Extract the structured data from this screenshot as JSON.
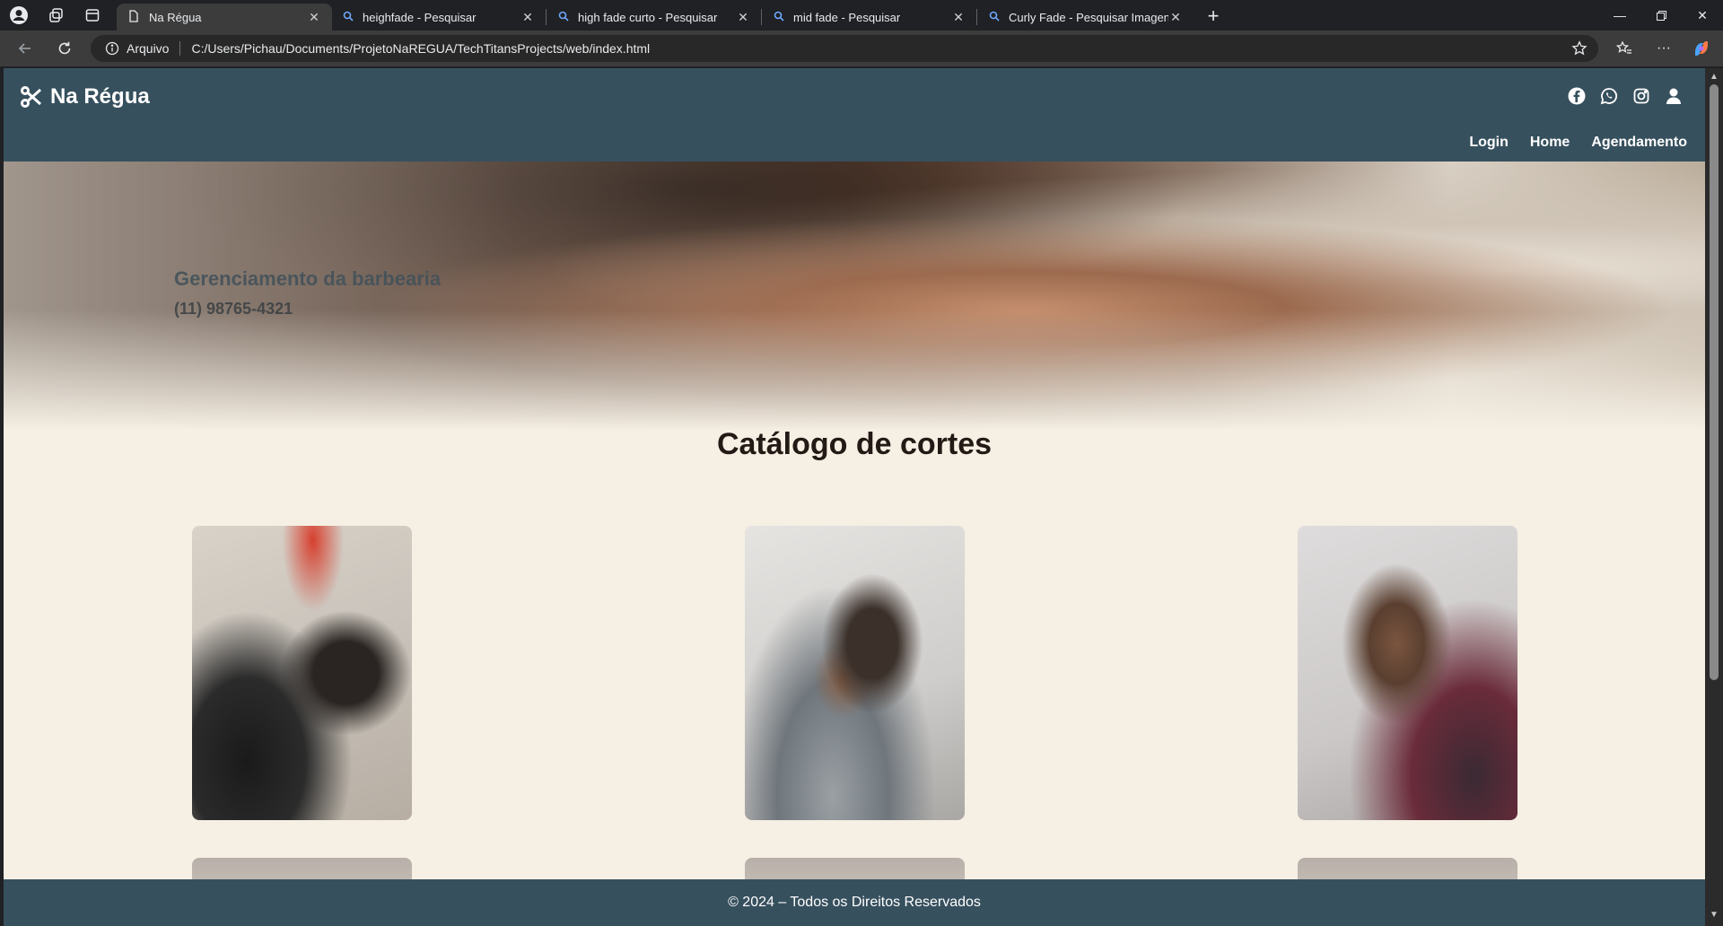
{
  "browser": {
    "tabs": [
      {
        "title": "Na Régua",
        "active": true,
        "icon": "page-icon"
      },
      {
        "title": "heighfade - Pesquisar",
        "active": false,
        "icon": "search-icon"
      },
      {
        "title": "high fade curto - Pesquisar",
        "active": false,
        "icon": "search-icon"
      },
      {
        "title": "mid fade - Pesquisar",
        "active": false,
        "icon": "search-icon"
      },
      {
        "title": "Curly Fade - Pesquisar Imagens",
        "active": false,
        "icon": "search-icon"
      }
    ],
    "address": {
      "security_label": "Arquivo",
      "url": "C:/Users/Pichau/Documents/ProjetoNaREGUA/TechTitansProjects/web/index.html"
    }
  },
  "site": {
    "brand": "Na Régua",
    "social_icons": [
      "facebook-icon",
      "whatsapp-icon",
      "instagram-icon",
      "user-icon"
    ],
    "menu": [
      "Login",
      "Home",
      "Agendamento"
    ],
    "hero": {
      "title": "Gerenciamento da barbearia",
      "phone": "(11) 98765-4321"
    },
    "catalog_title": "Catálogo de cortes",
    "footer": "© 2024 – Todos os Direitos Reservados"
  },
  "colors": {
    "header_bg": "#37505e",
    "page_bg": "#f5efe4",
    "title_text": "#241a15"
  }
}
